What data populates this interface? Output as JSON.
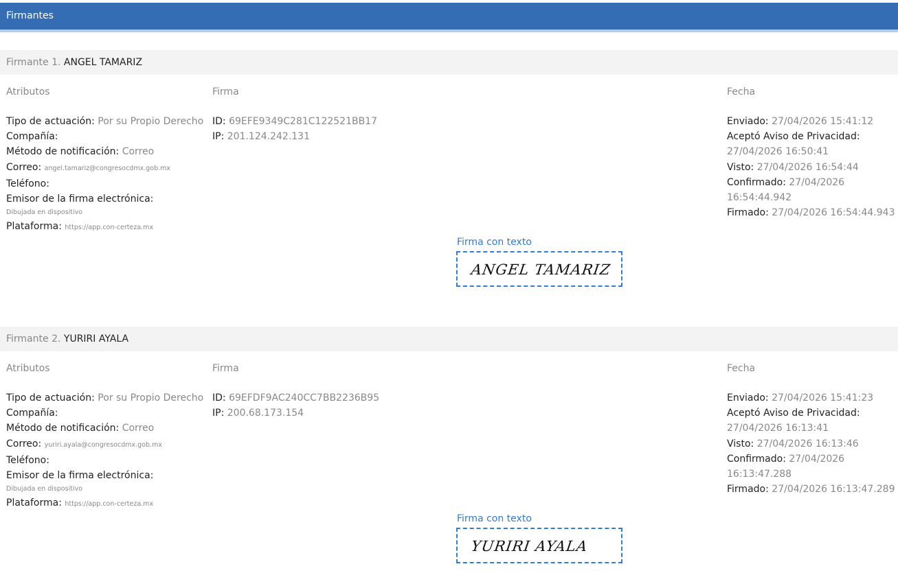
{
  "header": {
    "title": "Firmantes"
  },
  "signers": [
    {
      "prefix": "Firmante 1.",
      "name": "ANGEL TAMARIZ",
      "attr_header": "Atributos",
      "firma_header": "Firma",
      "fecha_header": "Fecha",
      "tipo_label": "Tipo de actuación:",
      "tipo_value": "Por su Propio Derecho",
      "compania_label": "Compañía:",
      "metodo_label": "Método de notificación:",
      "metodo_value": "Correo",
      "correo_label": "Correo:",
      "correo_value": "angel.tamariz@congresocdmx.gob.mx",
      "telefono_label": "Teléfono:",
      "emisor_label": "Emisor de la firma electrónica:",
      "emisor_value": "Dibujada en dispositivo",
      "plataforma_label": "Plataforma:",
      "plataforma_value": "https://app.con-certeza.mx",
      "id_label": "ID:",
      "id_value": "69EFE9349C281C122521BB17",
      "ip_label": "IP:",
      "ip_value": "201.124.242.131",
      "sig_label": "Firma con texto",
      "sig_text": "ANGEL TAMARIZ",
      "enviado_label": "Enviado:",
      "enviado_value": "27/04/2026 15:41:12",
      "aviso_label": "Aceptó Aviso de Privacidad:",
      "aviso_value": "27/04/2026 16:50:41",
      "visto_label": "Visto:",
      "visto_value": "27/04/2026 16:54:44",
      "confirmado_label": "Confirmado:",
      "confirmado_value": "27/04/2026 16:54:44.942",
      "firmado_label": "Firmado:",
      "firmado_value": "27/04/2026 16:54:44.943"
    },
    {
      "prefix": "Firmante 2.",
      "name": "YURIRI AYALA",
      "attr_header": "Atributos",
      "firma_header": "Firma",
      "fecha_header": "Fecha",
      "tipo_label": "Tipo de actuación:",
      "tipo_value": "Por su Propio Derecho",
      "compania_label": "Compañía:",
      "metodo_label": "Método de notificación:",
      "metodo_value": "Correo",
      "correo_label": "Correo:",
      "correo_value": "yuriri.ayala@congresocdmx.gob.mx",
      "telefono_label": "Teléfono:",
      "emisor_label": "Emisor de la firma electrónica:",
      "emisor_value": "Dibujada en dispositivo",
      "plataforma_label": "Plataforma:",
      "plataforma_value": "https://app.con-certeza.mx",
      "id_label": "ID:",
      "id_value": "69EFDF9AC240CC7BB2236B95",
      "ip_label": "IP:",
      "ip_value": "200.68.173.154",
      "sig_label": "Firma con texto",
      "sig_text": "YURIRI AYALA",
      "enviado_label": "Enviado:",
      "enviado_value": "27/04/2026 15:41:23",
      "aviso_label": "Aceptó Aviso de Privacidad:",
      "aviso_value": "27/04/2026 16:13:41",
      "visto_label": "Visto:",
      "visto_value": "27/04/2026 16:13:46",
      "confirmado_label": "Confirmado:",
      "confirmado_value": "27/04/2026 16:13:47.288",
      "firmado_label": "Firmado:",
      "firmado_value": "27/04/2026 16:13:47.289"
    }
  ]
}
